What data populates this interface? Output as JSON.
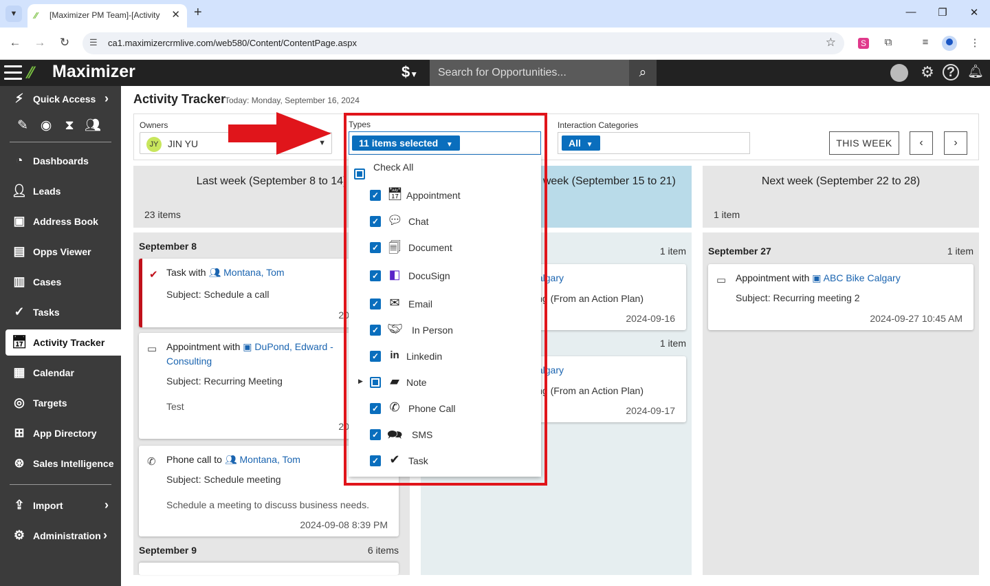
{
  "browser": {
    "tab_title": "[Maximizer PM Team]-[Activity",
    "url": "ca1.maximizercrmlive.com/web580/Content/ContentPage.aspx"
  },
  "app": {
    "brand": "Maximizer",
    "currency_symbol": "$",
    "search_placeholder": "Search for Opportunities..."
  },
  "sidebar": {
    "quick_access": "Quick Access",
    "items": [
      {
        "label": "Dashboards",
        "icon": "dashboard-icon"
      },
      {
        "label": "Leads",
        "icon": "leads-icon"
      },
      {
        "label": "Address Book",
        "icon": "address-book-icon"
      },
      {
        "label": "Opps Viewer",
        "icon": "opps-viewer-icon"
      },
      {
        "label": "Cases",
        "icon": "cases-icon"
      },
      {
        "label": "Tasks",
        "icon": "tasks-icon"
      },
      {
        "label": "Activity Tracker",
        "icon": "activity-tracker-icon"
      },
      {
        "label": "Calendar",
        "icon": "calendar-icon"
      },
      {
        "label": "Targets",
        "icon": "targets-icon"
      },
      {
        "label": "App Directory",
        "icon": "app-directory-icon"
      },
      {
        "label": "Sales Intelligence",
        "icon": "sales-intelligence-icon"
      }
    ],
    "import": "Import",
    "administration": "Administration"
  },
  "page": {
    "title": "Activity Tracker",
    "today": "Today: Monday, September 16, 2024"
  },
  "filters": {
    "owners_label": "Owners",
    "owner_initials": "JY",
    "owner_name": "JIN YU",
    "types_label": "Types",
    "types_value": "11 items selected",
    "ic_label": "Interaction Categories",
    "ic_value": "All",
    "this_week": "THIS WEEK"
  },
  "types_dropdown": {
    "check_all": "Check All",
    "options": [
      {
        "label": "Appointment",
        "icon": "appointment-icon"
      },
      {
        "label": "Chat",
        "icon": "chat-icon"
      },
      {
        "label": "Document",
        "icon": "document-icon"
      },
      {
        "label": "DocuSign",
        "icon": "docusign-icon"
      },
      {
        "label": "Email",
        "icon": "email-icon"
      },
      {
        "label": "In Person",
        "icon": "in-person-icon"
      },
      {
        "label": "Linkedin",
        "icon": "linkedin-icon"
      },
      {
        "label": "Note",
        "icon": "note-icon"
      },
      {
        "label": "Phone Call",
        "icon": "phone-call-icon"
      },
      {
        "label": "SMS",
        "icon": "sms-icon"
      },
      {
        "label": "Task",
        "icon": "task-icon"
      }
    ]
  },
  "columns": {
    "last": {
      "title": "Last week (September 8 to 14)",
      "count": "23 items",
      "day1": "September 8",
      "day2": "September 9",
      "day2_count": "6 items",
      "cards": [
        {
          "prefix": "Task with",
          "link": "Montana, Tom",
          "subject": "Subject: Schedule a call",
          "date": "2024-09-08"
        },
        {
          "prefix": "Appointment with",
          "link": "DuPond, Edward -",
          "link2": "Consulting",
          "subject": "Subject: Recurring Meeting",
          "note": "Test",
          "date": "2024-09-08"
        },
        {
          "prefix": "Phone call to",
          "link": "Montana, Tom",
          "subject": "Subject: Schedule meeting",
          "note": "Schedule a meeting to discuss business needs.",
          "date": "2024-09-08 8:39 PM"
        }
      ]
    },
    "this": {
      "title": "This week (September 15 to 21)",
      "group1_count": "1 item",
      "group2_count": "1 item",
      "cards": [
        {
          "link": "ABC Bike Calgary",
          "subject": "Subject: Recurring (From an Action Plan)",
          "date": "2024-09-16"
        },
        {
          "link": "ABC Bike Calgary",
          "subject": "Subject: Recurring (From an Action Plan)",
          "date": "2024-09-17"
        }
      ]
    },
    "next": {
      "title": "Next week (September 22 to 28)",
      "count": "1 item",
      "day1": "September 27",
      "day1_count": "1 item",
      "card": {
        "prefix": "Appointment with",
        "link": "ABC Bike Calgary",
        "subject": "Subject: Recurring meeting 2",
        "date": "2024-09-27 10:45 AM"
      }
    }
  },
  "colors": {
    "accent": "#0a6ebd",
    "annotation": "#e0151b",
    "sidebar": "#3b3b3b",
    "this_week_header": "#b9dbe9"
  }
}
